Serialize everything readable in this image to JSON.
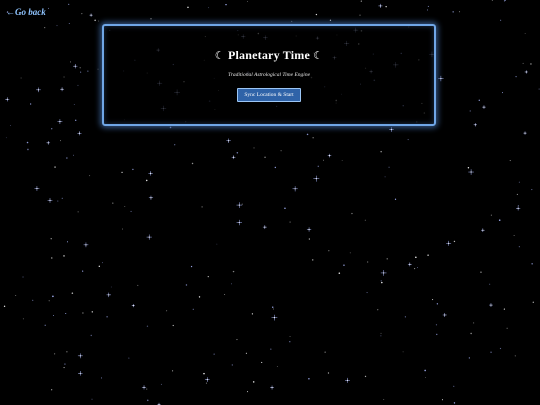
{
  "nav": {
    "back_label": "←Go back"
  },
  "panel": {
    "title": "Planetary Time",
    "moon_glyph": "☾",
    "subtitle": "Traditional Astrological Time Engine",
    "sync_button_label": "Sync Location & Start"
  },
  "colors": {
    "background": "#000000",
    "star": "#aab8ff",
    "panel_border": "#6fa6e6",
    "button": "#2f63a8",
    "link": "#8fc4ff"
  }
}
